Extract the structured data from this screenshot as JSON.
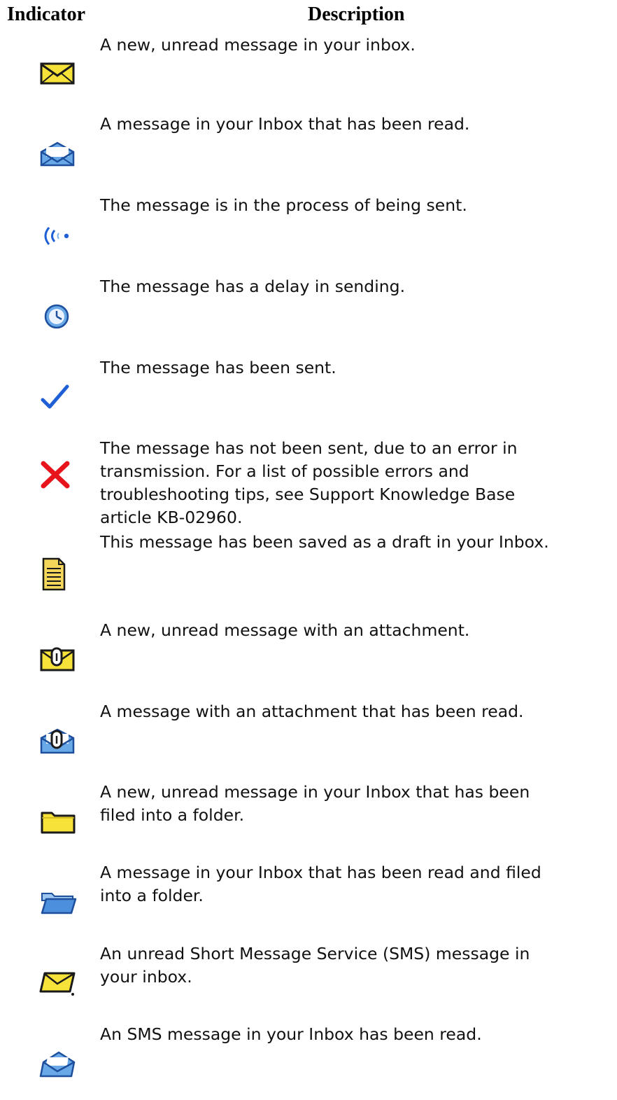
{
  "table": {
    "headers": {
      "indicator": "Indicator",
      "description": "Description"
    },
    "rows": [
      {
        "icon": "envelope-unread-icon",
        "description_lines": [
          "A new, unread message in your inbox."
        ]
      },
      {
        "icon": "envelope-read-icon",
        "description_lines": [
          "A message in your Inbox that has been read."
        ]
      },
      {
        "icon": "sending-signal-icon",
        "description_lines": [
          "The message is in the process of being sent."
        ]
      },
      {
        "icon": "clock-icon",
        "description_lines": [
          "The message has a delay in sending."
        ]
      },
      {
        "icon": "checkmark-icon",
        "description_lines": [
          "The message has been sent."
        ]
      },
      {
        "icon": "red-x-icon",
        "description_lines": [
          "The message has not been sent, due to an error in",
          "transmission. For a list of possible errors and",
          "troubleshooting tips, see Support Knowledge Base",
          "article KB-02960."
        ]
      },
      {
        "icon": "draft-document-icon",
        "description_lines": [
          "This message has been saved as a draft in your Inbox."
        ]
      },
      {
        "icon": "envelope-unread-attachment-icon",
        "description_lines": [
          "A new, unread message with an attachment."
        ]
      },
      {
        "icon": "envelope-read-attachment-icon",
        "description_lines": [
          "A message with an attachment that has been read."
        ]
      },
      {
        "icon": "folder-unread-icon",
        "description_lines": [
          "A new, unread message in your Inbox that has been",
          "filed into a folder."
        ]
      },
      {
        "icon": "folder-read-icon",
        "description_lines": [
          "A message in your Inbox that has been read and filed",
          "into a folder."
        ]
      },
      {
        "icon": "sms-unread-icon",
        "description_lines": [
          "An unread Short Message Service (SMS) message in",
          "your inbox."
        ]
      },
      {
        "icon": "sms-read-icon",
        "description_lines": [
          "An SMS message in your Inbox has been read."
        ]
      }
    ]
  },
  "colors": {
    "unread_yellow": "#f7e23a",
    "read_blue": "#6aa9e8",
    "accent_blue": "#1f5fd6",
    "error_red": "#e8141c",
    "outline": "#1a1a1a"
  }
}
